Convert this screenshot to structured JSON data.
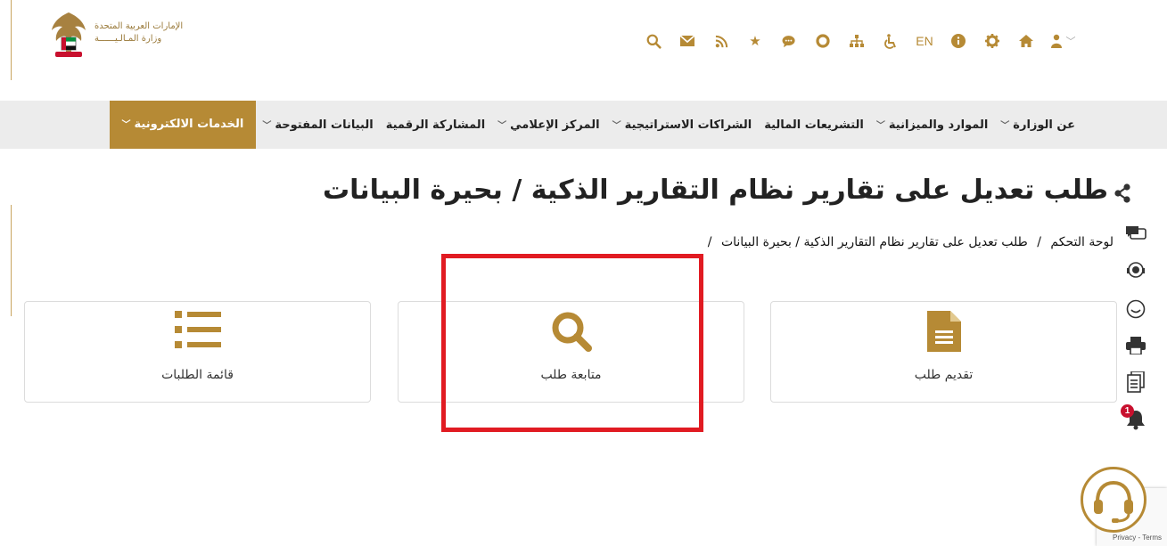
{
  "header": {
    "logo_line1": "الإمارات العربية المتحدة",
    "logo_line2": "وزارة المـالـيــــــة",
    "language_toggle": "EN",
    "icons": [
      "search-icon",
      "mail-icon",
      "rss-icon",
      "star-icon",
      "chat-icon",
      "support-ring-icon",
      "sitemap-icon",
      "accessibility-icon",
      "language-toggle",
      "info-icon",
      "gear-icon",
      "home-icon",
      "user-icon"
    ]
  },
  "nav": {
    "items": [
      {
        "label": "عن الوزارة",
        "dropdown": true
      },
      {
        "label": "الموارد والميزانية",
        "dropdown": true
      },
      {
        "label": "التشريعات المالية",
        "dropdown": false
      },
      {
        "label": "الشراكات الاستراتيجية",
        "dropdown": true
      },
      {
        "label": "المركز الإعلامي",
        "dropdown": true
      },
      {
        "label": "المشاركة الرقمية",
        "dropdown": false
      },
      {
        "label": "البيانات المفتوحة",
        "dropdown": true
      },
      {
        "label": "الخدمات الالكترونية",
        "dropdown": true,
        "active": true
      }
    ],
    "accent": "#b68a35"
  },
  "page": {
    "title": "طلب تعديل على تقارير نظام التقارير الذكية / بحيرة البيانات",
    "breadcrumb": {
      "home": "لوحة التحكم",
      "sep": "/",
      "current": "طلب تعديل على تقارير نظام التقارير الذكية / بحيرة البيانات",
      "trail_sep": "/"
    }
  },
  "cards": {
    "submit": "تقديم طلب",
    "track": "متابعة طلب",
    "list": "قائمة الطلبات"
  },
  "sidebar": {
    "notification_count": "1"
  },
  "recaptcha": {
    "text": "Privacy - Terms"
  },
  "colors": {
    "gold": "#b68a35",
    "highlight": "#e11b22"
  }
}
